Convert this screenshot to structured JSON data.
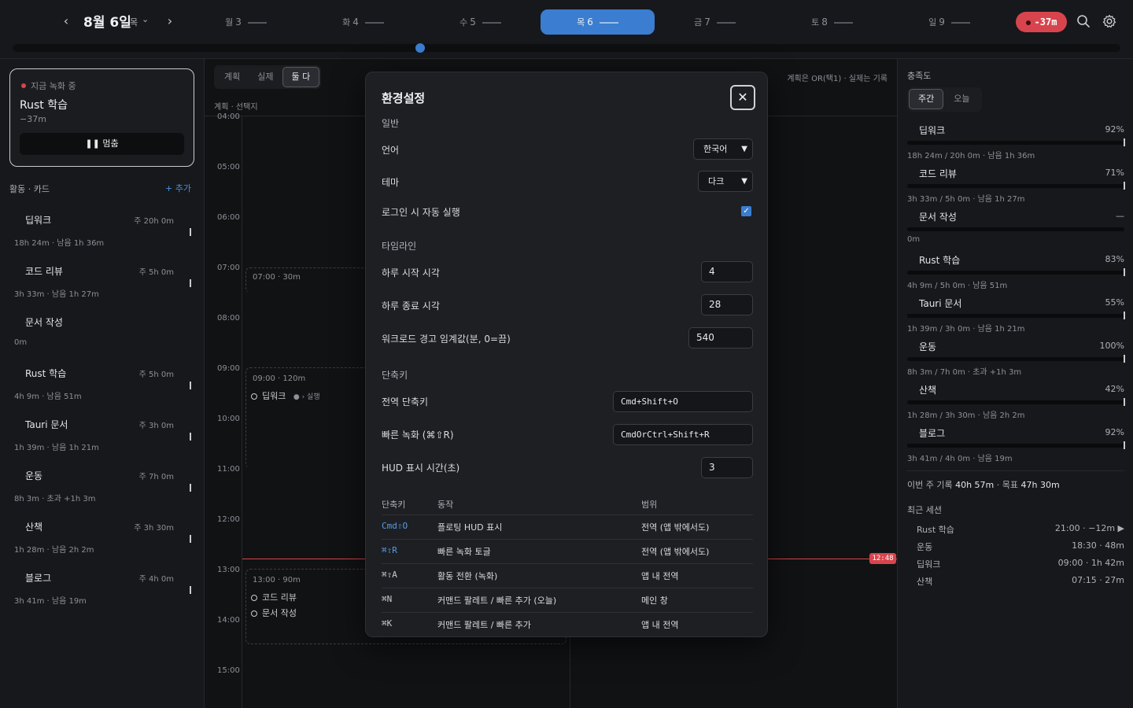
{
  "topbar": {
    "prev": "‹",
    "next": "›",
    "date": "8월 6일",
    "weekday": "목",
    "chevron": "⌄",
    "days": [
      {
        "wd": "월",
        "num": "3"
      },
      {
        "wd": "화",
        "num": "4"
      },
      {
        "wd": "수",
        "num": "5"
      },
      {
        "wd": "목",
        "num": "6"
      },
      {
        "wd": "금",
        "num": "7"
      },
      {
        "wd": "토",
        "num": "8"
      },
      {
        "wd": "일",
        "num": "9"
      }
    ],
    "active_day": 3,
    "overtime": "-37m",
    "day_progress": 0.367,
    "colors": {
      "accent": "#3b7dd0",
      "danger": "#d8444d"
    }
  },
  "left": {
    "recording": {
      "label": "지금 녹화 중",
      "title": "Rust 학습",
      "sub": "−37m",
      "stop": "❚❚ 멈춤"
    },
    "section": "활동 · 카드",
    "add": "+ 추가",
    "activities": [
      {
        "name": "딥워크",
        "goal": "주 20h 0m",
        "sub": "18h 24m · 남음 1h 36m"
      },
      {
        "name": "코드 리뷰",
        "goal": "주 5h 0m",
        "sub": "3h 33m · 남음 1h 27m"
      },
      {
        "name": "문서 작성",
        "goal": "",
        "sub": "0m"
      },
      {
        "name": "Rust 학습",
        "goal": "주 5h 0m",
        "sub": "4h 9m · 남음 51m"
      },
      {
        "name": "Tauri 문서",
        "goal": "주 3h 0m",
        "sub": "1h 39m · 남음 1h 21m"
      },
      {
        "name": "운동",
        "goal": "주 7h 0m",
        "sub": "8h 3m · 초과 +1h 3m"
      },
      {
        "name": "산책",
        "goal": "주 3h 30m",
        "sub": "1h 28m · 남음 2h 2m"
      },
      {
        "name": "블로그",
        "goal": "주 4h 0m",
        "sub": "3h 41m · 남음 19m"
      }
    ]
  },
  "center": {
    "tabs": [
      "계획",
      "실제",
      "둘 다"
    ],
    "selected_tab": 2,
    "crumb": "계획 · 선택지",
    "note": "계획은 OR(택1) · 실제는 기록",
    "hours": [
      "04:00",
      "05:00",
      "06:00",
      "07:00",
      "08:00",
      "09:00",
      "10:00",
      "11:00",
      "12:00",
      "13:00",
      "14:00",
      "15:00"
    ],
    "blocks": [
      {
        "time": "07:00 · 30m",
        "items": []
      },
      {
        "time": "09:00 · 120m",
        "items": [
          "딥워크"
        ],
        "badge": "› 실행"
      },
      {
        "time": "13:00 · 90m",
        "items": [
          "코드 리뷰",
          "문서 작성"
        ]
      }
    ],
    "now": "12:48"
  },
  "right": {
    "title": "충족도",
    "tabs": [
      "주간",
      "오늘"
    ],
    "selected_tab": 0,
    "rows": [
      {
        "name": "딥워크",
        "pct": "92%",
        "fill": 0.92,
        "sub": "18h 24m / 20h 0m · 남음 1h 36m"
      },
      {
        "name": "코드 리뷰",
        "pct": "71%",
        "fill": 0.71,
        "sub": "3h 33m / 5h 0m · 남음 1h 27m"
      },
      {
        "name": "문서 작성",
        "pct": "—",
        "fill": 0,
        "sub": "0m"
      },
      {
        "name": "Rust 학습",
        "pct": "83%",
        "fill": 0.83,
        "sub": "4h 9m / 5h 0m · 남음 51m"
      },
      {
        "name": "Tauri 문서",
        "pct": "55%",
        "fill": 0.55,
        "sub": "1h 39m / 3h 0m · 남음 1h 21m"
      },
      {
        "name": "운동",
        "pct": "100%",
        "fill": 1.0,
        "sub": "8h 3m / 7h 0m · 초과 +1h 3m"
      },
      {
        "name": "산책",
        "pct": "42%",
        "fill": 0.42,
        "sub": "1h 28m / 3h 30m · 남음 2h 2m"
      },
      {
        "name": "블로그",
        "pct": "92%",
        "fill": 0.92,
        "sub": "3h 41m / 4h 0m · 남음 19m"
      }
    ],
    "week_label": "이번 주 기록",
    "week_value": "40h 57m",
    "goal_label": "목표",
    "goal_value": "47h 30m",
    "recent_title": "최근 세션",
    "sessions": [
      {
        "name": "Rust 학습",
        "value": "21:00 · −12m ▶"
      },
      {
        "name": "운동",
        "value": "18:30 · 48m"
      },
      {
        "name": "딥워크",
        "value": "09:00 · 1h 42m"
      },
      {
        "name": "산책",
        "value": "07:15 · 27m"
      }
    ]
  },
  "settings": {
    "title": "환경설정",
    "close": "✕",
    "general": "일반",
    "language_label": "언어",
    "language_value": "한국어",
    "theme_label": "테마",
    "theme_value": "다크",
    "autostart_label": "로그인 시 자동 실행",
    "autostart_checked": true,
    "timeline": "타임라인",
    "day_start_label": "하루 시작 시각",
    "day_start_value": "4",
    "day_end_label": "하루 종료 시각",
    "day_end_value": "28",
    "warn_label": "워크로드 경고 임계값(분, 0=끔)",
    "warn_value": "540",
    "shortcuts": "단축키",
    "global_label": "전역 단축키",
    "global_value": "Cmd+Shift+O",
    "quick_label": "빠른 녹화 (⌘⇧R)",
    "quick_value": "CmdOrCtrl+Shift+R",
    "hud_label": "HUD 표시 시간(초)",
    "hud_value": "3",
    "table_headers": [
      "단축키",
      "동작",
      "범위"
    ],
    "table_rows": [
      {
        "key": "Cmd⇧O",
        "action": "플로팅 HUD 표시",
        "scope": "전역 (앱 밖에서도)"
      },
      {
        "key": "⌘⇧R",
        "action": "빠른 녹화 토글",
        "scope": "전역 (앱 밖에서도)"
      },
      {
        "key": "⌘⇧A",
        "action": "활동 전환 (녹화)",
        "scope": "앱 내 전역"
      },
      {
        "key": "⌘N",
        "action": "커맨드 팔레트 / 빠른 추가 (오늘)",
        "scope": "메인 창"
      },
      {
        "key": "⌘K",
        "action": "커맨드 팔레트 / 빠른 추가",
        "scope": "앱 내 전역"
      }
    ]
  }
}
